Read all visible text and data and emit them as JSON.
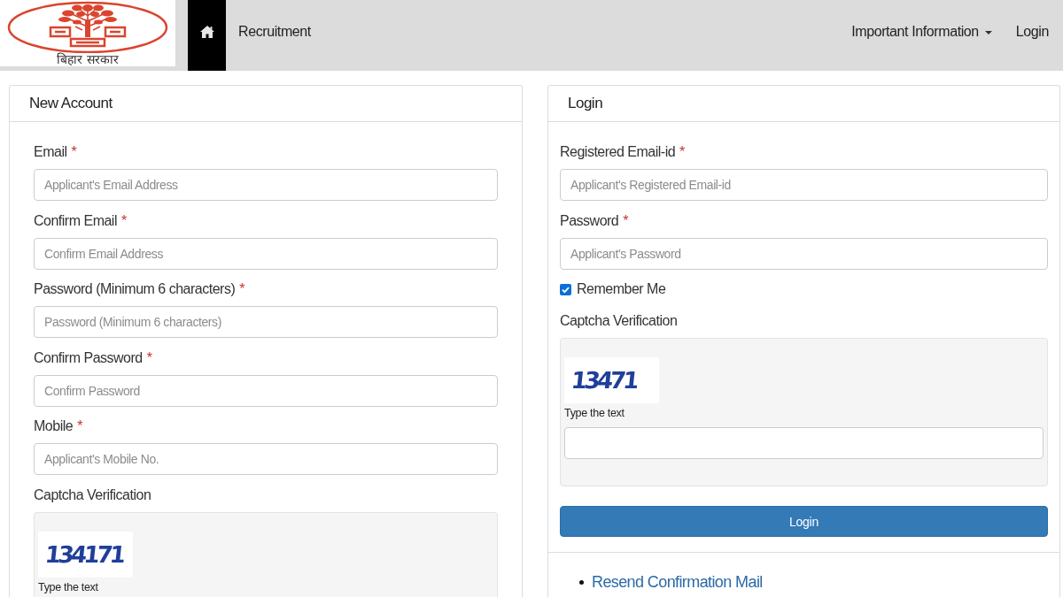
{
  "navbar": {
    "logo_caption": "बिहार सरकार",
    "brand": "Recruitment",
    "menu": [
      {
        "label": "Important Information",
        "kind": "dropdown"
      },
      {
        "label": "Login",
        "kind": "link"
      }
    ]
  },
  "new_account": {
    "title": "New Account",
    "fields": [
      {
        "label": "Email",
        "required_mark": "*",
        "placeholder": "Applicant's Email Address"
      },
      {
        "label": "Confirm Email",
        "required_mark": "*",
        "placeholder": "Confirm Email Address"
      },
      {
        "label": "Password (Minimum 6 characters)",
        "required_mark": "*",
        "placeholder": "Password (Minimum 6 characters)"
      },
      {
        "label": "Confirm Password",
        "required_mark": "*",
        "placeholder": "Confirm Password"
      },
      {
        "label": "Mobile",
        "required_mark": "*",
        "placeholder": "Applicant's Mobile No."
      }
    ],
    "captcha": {
      "label": "Captcha Verification",
      "image_text": "134171",
      "hint": "Type the text"
    }
  },
  "login": {
    "title": "Login",
    "fields": [
      {
        "label": "Registered Email-id",
        "required_mark": "*",
        "placeholder": "Applicant's Registered Email-id"
      },
      {
        "label": "Password",
        "required_mark": "*",
        "placeholder": "Applicant's Password"
      }
    ],
    "remember_me": {
      "label": "Remember Me",
      "checked": true
    },
    "captcha": {
      "label": "Captcha Verification",
      "image_text": "13471",
      "hint": "Type the text",
      "answer_field": true
    },
    "button": "Login",
    "links": [
      "Resend Confirmation Mail"
    ]
  }
}
